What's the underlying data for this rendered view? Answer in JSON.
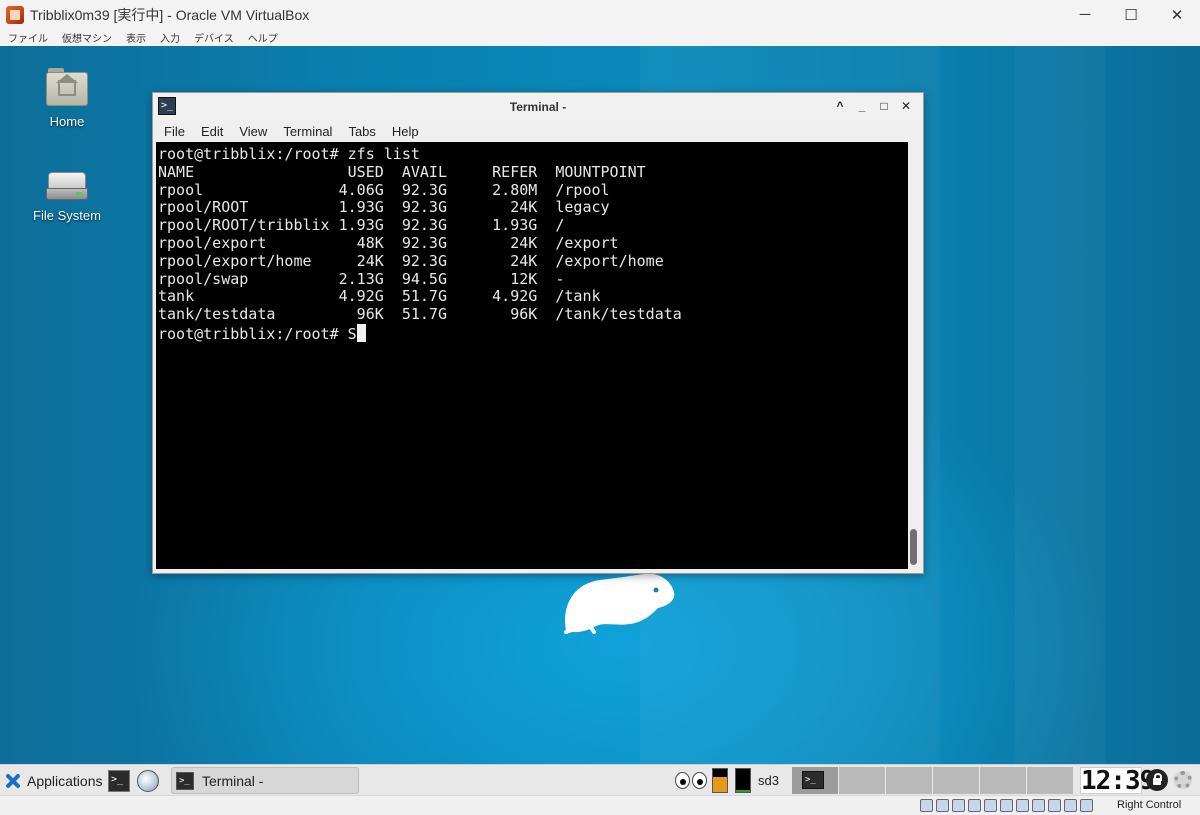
{
  "host": {
    "title": "Tribblix0m39 [実行中] - Oracle VM VirtualBox",
    "controls": {
      "minimize": "─",
      "maximize": "☐",
      "close": "✕"
    },
    "menu": [
      "ファイル",
      "仮想マシン",
      "表示",
      "入力",
      "デバイス",
      "ヘルプ"
    ],
    "host_key_label": "Right Control",
    "status_icon_names": [
      "hard-disk-icon",
      "optical-drive-icon",
      "audio-icon",
      "network-icon",
      "usb-icon",
      "shared-folders-icon",
      "display-icon",
      "video-capture-icon",
      "cpu-icon",
      "mouse-integration-icon",
      "keyboard-icon"
    ]
  },
  "desktop": {
    "icons": [
      {
        "label": "Home",
        "icon": "home-folder-icon"
      },
      {
        "label": "File System",
        "icon": "drive-icon"
      }
    ]
  },
  "terminal": {
    "title": "Terminal -",
    "controls": {
      "minimize": "^",
      "shade": "_",
      "maximize": "□",
      "close": "✕"
    },
    "menu": [
      "File",
      "Edit",
      "View",
      "Terminal",
      "Tabs",
      "Help"
    ],
    "prompt_line": "root@tribblix:/root# zfs list",
    "table": {
      "headers": [
        "NAME",
        "USED",
        "AVAIL",
        "REFER",
        "MOUNTPOINT"
      ],
      "rows": [
        [
          "rpool",
          "4.06G",
          "92.3G",
          "2.80M",
          "/rpool"
        ],
        [
          "rpool/ROOT",
          "1.93G",
          "92.3G",
          "24K",
          "legacy"
        ],
        [
          "rpool/ROOT/tribblix",
          "1.93G",
          "92.3G",
          "1.93G",
          "/"
        ],
        [
          "rpool/export",
          "48K",
          "92.3G",
          "24K",
          "/export"
        ],
        [
          "rpool/export/home",
          "24K",
          "92.3G",
          "24K",
          "/export/home"
        ],
        [
          "rpool/swap",
          "2.13G",
          "94.5G",
          "12K",
          "-"
        ],
        [
          "tank",
          "4.92G",
          "51.7G",
          "4.92G",
          "/tank"
        ],
        [
          "tank/testdata",
          "96K",
          "51.7G",
          "96K",
          "/tank/testdata"
        ]
      ]
    },
    "current_prompt": "root@tribblix:/root# ",
    "current_input": "S"
  },
  "panel": {
    "applications_label": "Applications",
    "task_label": "Terminal -",
    "disk_label": "sd3",
    "clock": "12:39",
    "cpu_monitor_level": 0.65,
    "disk_monitor_level": 0.1,
    "colors": {
      "cpu_fill": "#e39a1c",
      "disk_fill": "#2f9b2f"
    }
  }
}
